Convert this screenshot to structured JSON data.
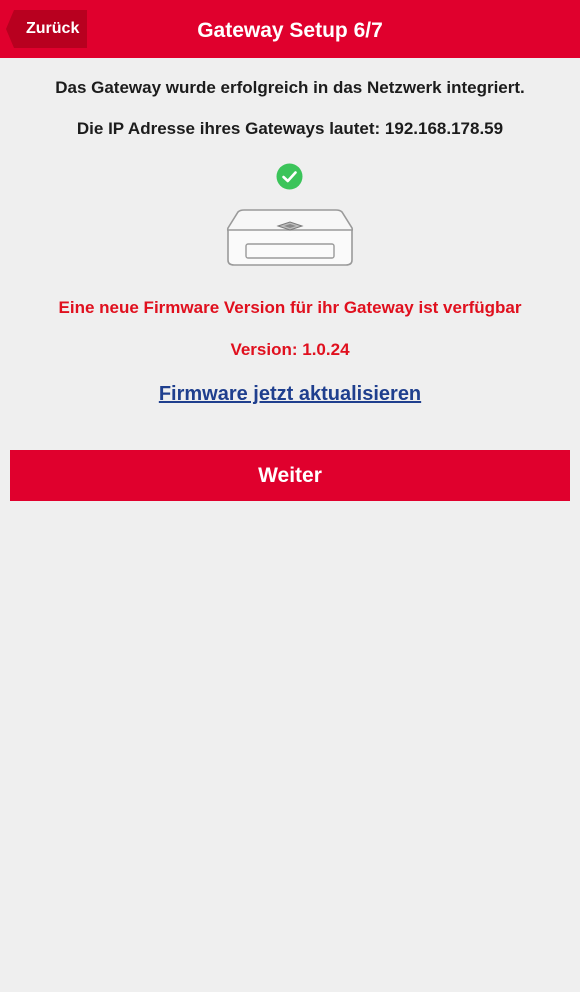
{
  "header": {
    "back_label": "Zurück",
    "title": "Gateway Setup 6/7"
  },
  "main": {
    "success_message": "Das Gateway wurde erfolgreich in das Netzwerk integriert.",
    "ip_message": "Die IP Adresse ihres Gateways lautet: 192.168.178.59",
    "firmware_notice": "Eine neue Firmware Version für ihr Gateway ist verfügbar",
    "version": "Version: 1.0.24",
    "update_link": "Firmware jetzt aktualisieren",
    "next_label": "Weiter"
  },
  "icons": {
    "back": "chevron-left-icon",
    "check": "check-circle-icon",
    "gateway": "gateway-device-image"
  },
  "colors": {
    "brand": "#e0002d",
    "back_button": "#b8001f",
    "alert_text": "#e0101e",
    "link": "#1f3f8e",
    "success": "#3bc45a",
    "background": "#efefef"
  }
}
